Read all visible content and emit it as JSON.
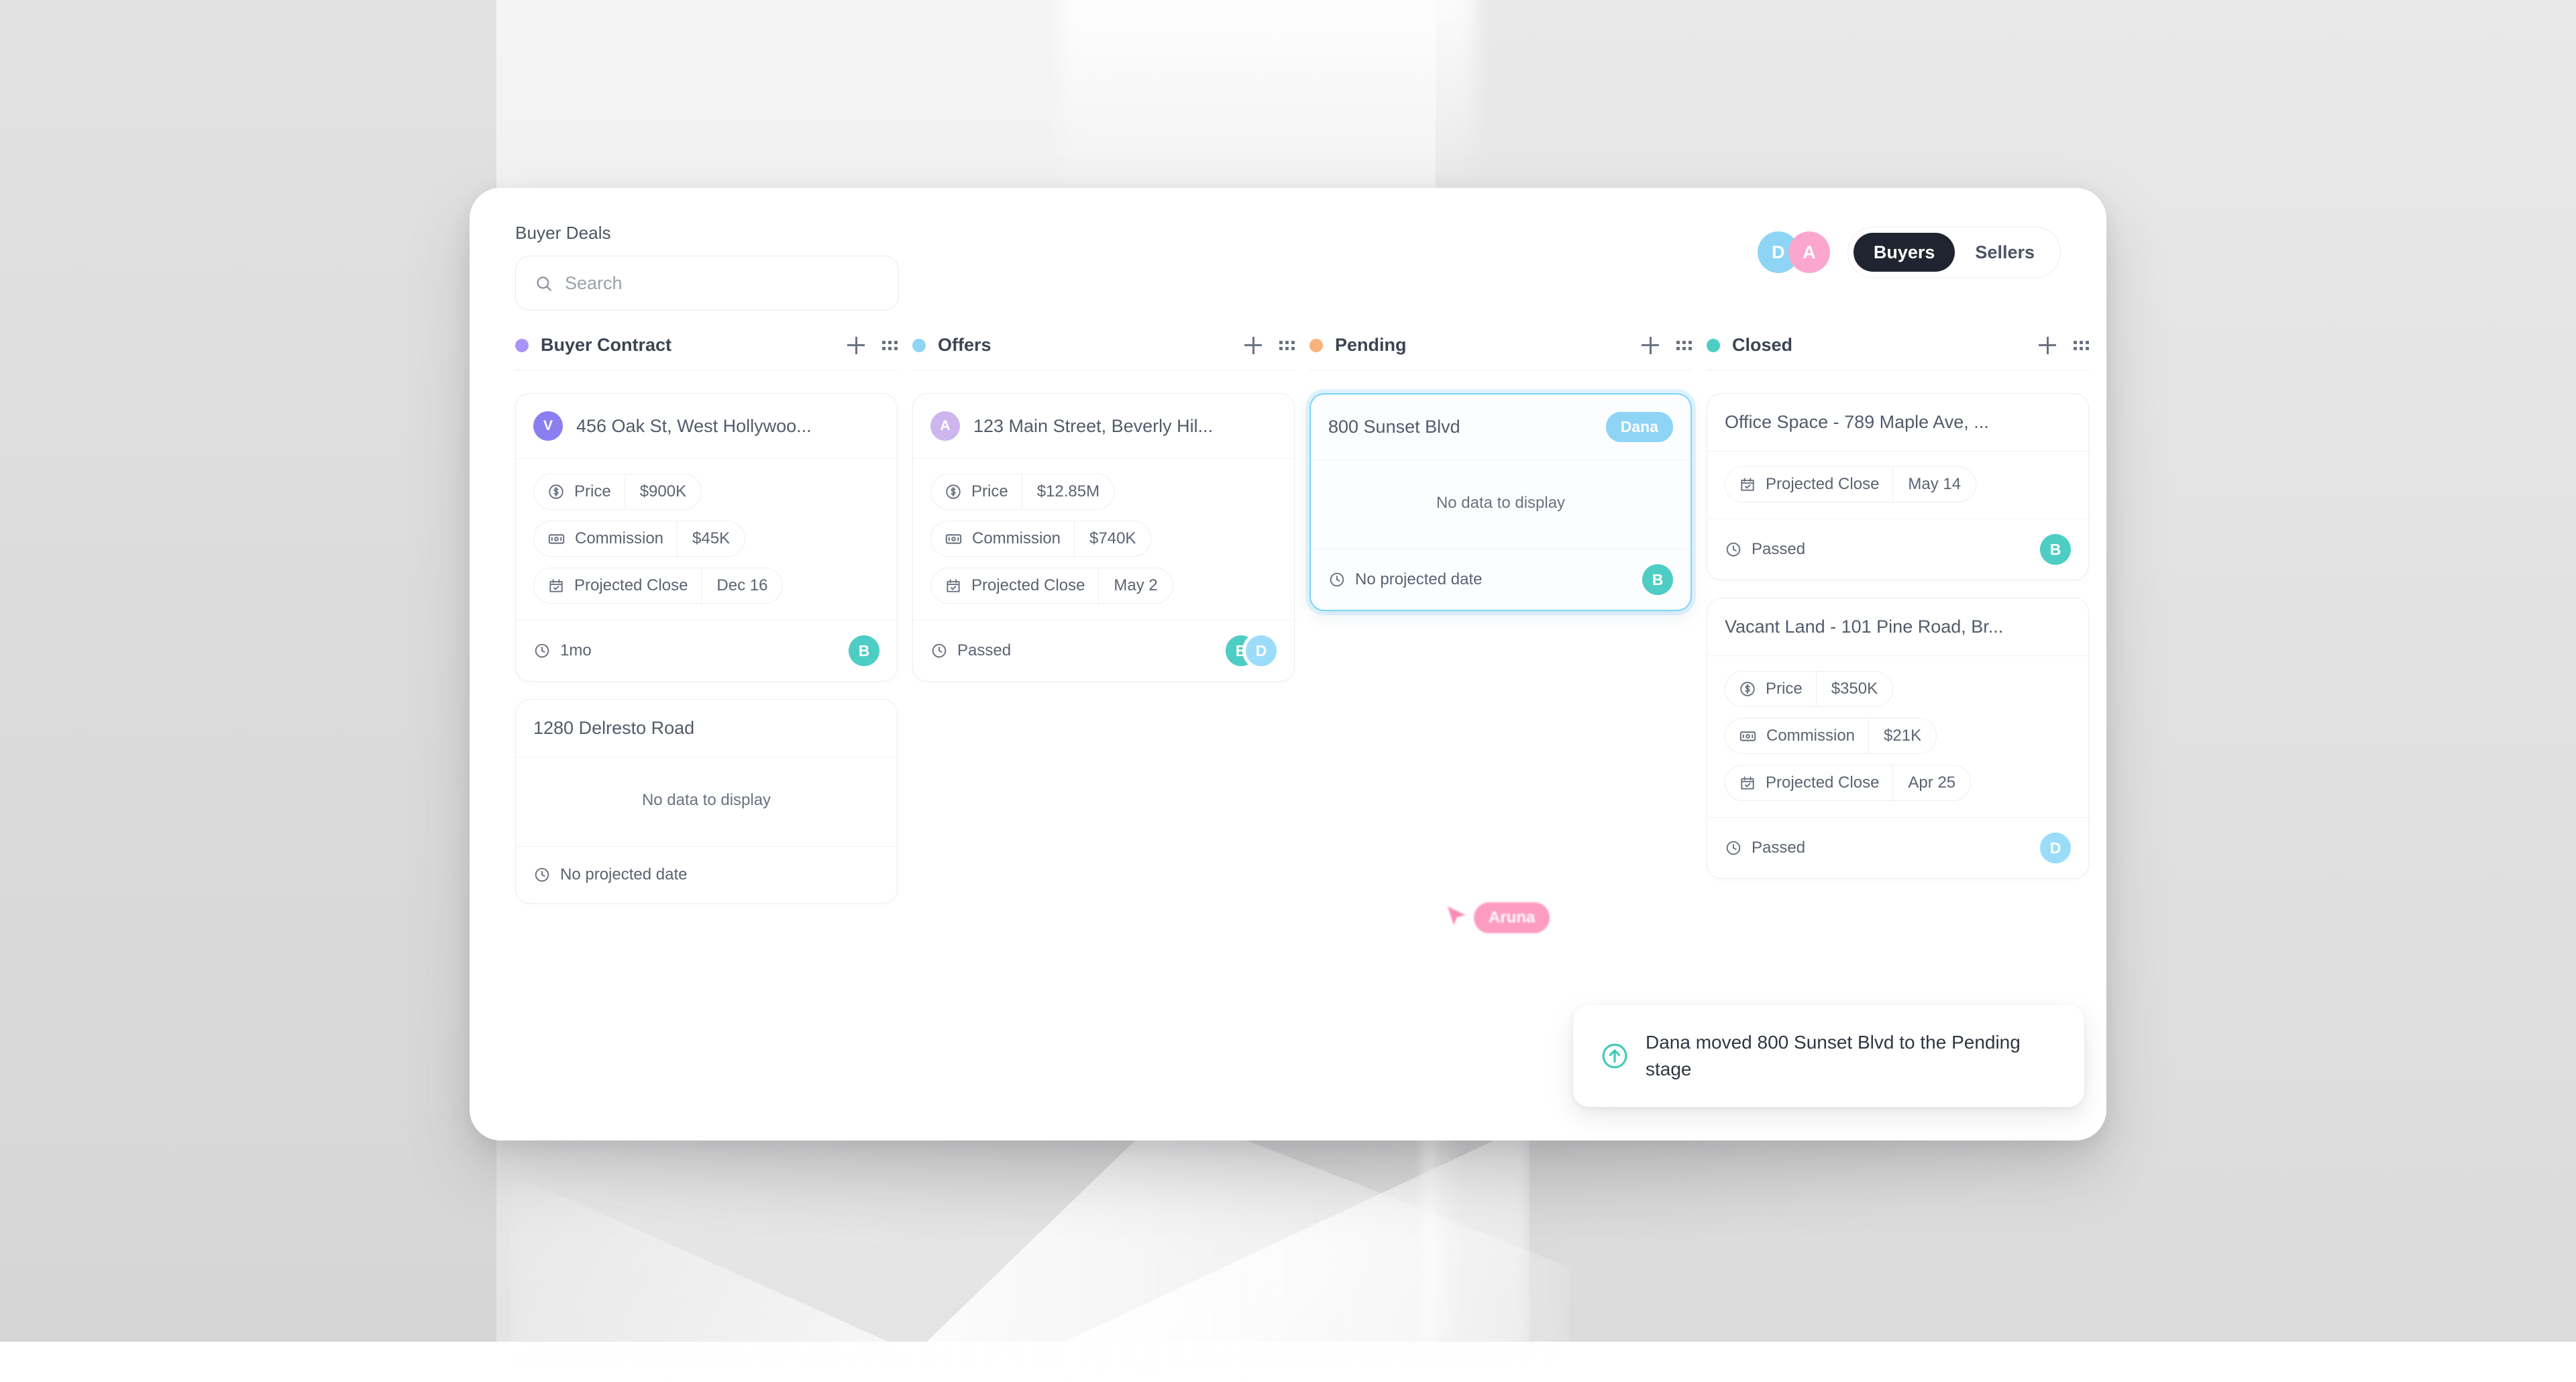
{
  "header": {
    "page_title": "Buyer Deals",
    "search": {
      "value": "",
      "placeholder": "Search",
      "icon": "search-icon"
    },
    "avatars": [
      {
        "initial": "D",
        "color": "#8ed4f5"
      },
      {
        "initial": "A",
        "color": "#fba7cd"
      }
    ],
    "segmented": {
      "options": [
        "Buyers",
        "Sellers"
      ],
      "buyers_label": "Buyers",
      "sellers_label": "Sellers",
      "selected": "Buyers"
    }
  },
  "board": {
    "add_icon": "plus-icon",
    "menu_icon": "grid-dots-icon",
    "columns": [
      {
        "title": "Buyer Contract",
        "dot_color": "#a894f5",
        "cards": [
          {
            "title": "456 Oak St, West Hollywoo...",
            "avatar": {
              "initial": "V",
              "color": "#8b7ef0"
            },
            "fields": [
              {
                "icon": "dollar-circle-icon",
                "label": "Price",
                "value": "$900K"
              },
              {
                "icon": "money-bill-icon",
                "label": "Commission",
                "value": "$45K"
              },
              {
                "icon": "calendar-check-icon",
                "label": "Projected Close",
                "value": "Dec 16"
              }
            ],
            "footer_text": "1mo",
            "footer_avatars": [
              {
                "initial": "B",
                "color": "#4ecdc4"
              }
            ]
          },
          {
            "title": "1280 Delresto Road",
            "avatar": null,
            "empty_text": "No data to display",
            "fields": [],
            "footer_text": "No projected date",
            "footer_avatars": []
          }
        ]
      },
      {
        "title": "Offers",
        "dot_color": "#8ed4f5",
        "cards": [
          {
            "title": "123 Main Street, Beverly Hil...",
            "avatar": {
              "initial": "A",
              "color": "#cdb6ee"
            },
            "fields": [
              {
                "icon": "dollar-circle-icon",
                "label": "Price",
                "value": "$12.85M"
              },
              {
                "icon": "money-bill-icon",
                "label": "Commission",
                "value": "$740K"
              },
              {
                "icon": "calendar-check-icon",
                "label": "Projected Close",
                "value": "May 2"
              }
            ],
            "footer_text": "Passed",
            "footer_avatars": [
              {
                "initial": "B",
                "color": "#4ecdc4"
              },
              {
                "initial": "D",
                "color": "#9bdcf8"
              }
            ]
          }
        ]
      },
      {
        "title": "Pending",
        "dot_color": "#f9b27a",
        "cards": [
          {
            "title": "800 Sunset Blvd",
            "avatar": null,
            "owner_chip": "Dana",
            "dragging": true,
            "empty_text": "No data to display",
            "fields": [],
            "footer_text": "No projected date",
            "footer_avatars": [
              {
                "initial": "B",
                "color": "#4ecdc4"
              }
            ]
          }
        ]
      },
      {
        "title": "Closed",
        "dot_color": "#4ecdc4",
        "cards": [
          {
            "title": "Office Space - 789 Maple Ave, ...",
            "avatar": null,
            "fields": [
              {
                "icon": "calendar-check-icon",
                "label": "Projected Close",
                "value": "May 14"
              }
            ],
            "footer_text": "Passed",
            "footer_avatars": [
              {
                "initial": "B",
                "color": "#4ecdc4"
              }
            ]
          },
          {
            "title": "Vacant Land - 101 Pine Road, Br...",
            "avatar": null,
            "fields": [
              {
                "icon": "dollar-circle-icon",
                "label": "Price",
                "value": "$350K"
              },
              {
                "icon": "money-bill-icon",
                "label": "Commission",
                "value": "$21K"
              },
              {
                "icon": "calendar-check-icon",
                "label": "Projected Close",
                "value": "Apr 25"
              }
            ],
            "footer_text": "Passed",
            "footer_avatars": [
              {
                "initial": "D",
                "color": "#9bdcf8"
              }
            ]
          }
        ]
      }
    ]
  },
  "remote_cursor": {
    "label": "Aruna",
    "color": "#fb9cc0",
    "icon": "cursor-arrow-icon"
  },
  "toast": {
    "message": "Dana moved 800 Sunset Blvd to the Pending stage",
    "icon": "arrow-up-circle-icon",
    "icon_color": "#3ec9b8"
  }
}
